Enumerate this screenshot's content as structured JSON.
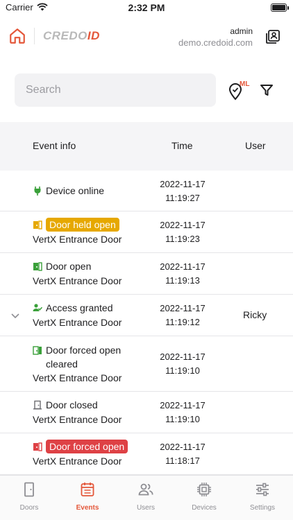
{
  "status_bar": {
    "carrier": "Carrier",
    "time": "2:32 PM"
  },
  "header": {
    "logo_part1": "CREDO",
    "logo_part2": "ID",
    "user_name": "admin",
    "user_domain": "demo.credoid.com"
  },
  "search": {
    "placeholder": "Search",
    "ml_label": "ML"
  },
  "table": {
    "columns": [
      "Event info",
      "Time",
      "User"
    ],
    "rows": [
      {
        "icon": "plug-icon",
        "event": "Device online",
        "door": "",
        "date": "2022-11-17",
        "time": "11:19:27",
        "user": "",
        "badge": ""
      },
      {
        "icon": "door-held-open-icon",
        "event": "Door held open",
        "door": "VertX Entrance Door",
        "date": "2022-11-17",
        "time": "11:19:23",
        "user": "",
        "badge": "warning"
      },
      {
        "icon": "door-open-icon",
        "event": "Door open",
        "door": "VertX Entrance Door",
        "date": "2022-11-17",
        "time": "11:19:13",
        "user": "",
        "badge": ""
      },
      {
        "icon": "user-check-icon",
        "event": "Access granted",
        "door": "VertX Entrance Door",
        "date": "2022-11-17",
        "time": "11:19:12",
        "user": "Ricky",
        "badge": ""
      },
      {
        "icon": "door-cleared-icon",
        "event": "Door forced open",
        "event2": "cleared",
        "door": "VertX Entrance Door",
        "date": "2022-11-17",
        "time": "11:19:10",
        "user": "",
        "badge": ""
      },
      {
        "icon": "door-closed-icon",
        "event": "Door closed",
        "door": "VertX Entrance Door",
        "date": "2022-11-17",
        "time": "11:19:10",
        "user": "",
        "badge": ""
      },
      {
        "icon": "door-forced-icon",
        "event": "Door forced open",
        "door": "VertX Entrance Door",
        "date": "2022-11-17",
        "time": "11:18:17",
        "user": "",
        "badge": "danger"
      }
    ]
  },
  "tabs": [
    {
      "label": "Doors",
      "icon": "door-icon",
      "active": false
    },
    {
      "label": "Events",
      "icon": "calendar-list-icon",
      "active": true
    },
    {
      "label": "Users",
      "icon": "users-icon",
      "active": false
    },
    {
      "label": "Devices",
      "icon": "chip-icon",
      "active": false
    },
    {
      "label": "Settings",
      "icon": "sliders-icon",
      "active": false
    }
  ],
  "colors": {
    "accent": "#e4573a",
    "green": "#3aa03a",
    "warning": "#e6a800",
    "danger": "#de4145",
    "muted": "#8e8e93"
  }
}
